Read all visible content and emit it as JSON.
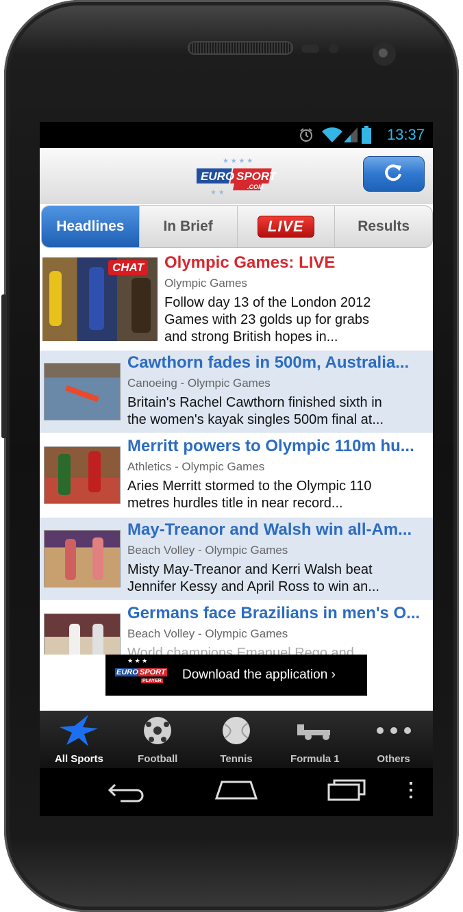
{
  "status_bar": {
    "time": "13:37",
    "icons": [
      "alarm-icon",
      "wifi-icon",
      "signal-icon",
      "battery-icon"
    ]
  },
  "header": {
    "logo_text_1": "EURO",
    "logo_text_2": "SPORT",
    "logo_text_3": ".COM"
  },
  "tabs": [
    {
      "label": "Headlines",
      "active": true
    },
    {
      "label": "In Brief",
      "active": false
    },
    {
      "label": "LIVE",
      "active": false
    },
    {
      "label": "Results",
      "active": false
    }
  ],
  "articles": [
    {
      "title": "Olympic Games: LIVE",
      "badge": "CHAT",
      "category": "Olympic Games",
      "desc": [
        "Follow day 13 of the London 2012",
        "Games with 23 golds up for grabs",
        "and strong British hopes in..."
      ]
    },
    {
      "title": "Cawthorn fades in 500m, Australia...",
      "category": "Canoeing - Olympic Games",
      "desc": [
        "Britain's Rachel Cawthorn finished sixth in",
        "the women's kayak singles 500m final at..."
      ]
    },
    {
      "title": "Merritt powers to Olympic 110m hu...",
      "category": "Athletics - Olympic Games",
      "desc": [
        "Aries Merritt stormed to the Olympic 110",
        "metres hurdles title in near record..."
      ]
    },
    {
      "title": "May-Treanor and Walsh win all-Am...",
      "category": "Beach Volley - Olympic Games",
      "desc": [
        "Misty May-Treanor and Kerri Walsh beat",
        "Jennifer Kessy and April Ross to win an..."
      ]
    },
    {
      "title": "Germans face Brazilians in men's O...",
      "category": "Beach Volley - Olympic Games",
      "desc": [
        "World champions Emanuel Rego and"
      ]
    }
  ],
  "banner": {
    "logo_1": "EURO",
    "logo_2": "SPORT",
    "logo_3": "PLAYER",
    "text": "Download the application ›"
  },
  "bottom_nav": [
    {
      "label": "All Sports",
      "icon": "star-icon"
    },
    {
      "label": "Football",
      "icon": "football-icon"
    },
    {
      "label": "Tennis",
      "icon": "tennis-ball-icon"
    },
    {
      "label": "Formula 1",
      "icon": "formula1-car-icon"
    },
    {
      "label": "Others",
      "icon": "more-dots-icon"
    }
  ],
  "colors": {
    "accent_blue": "#2c6cc0",
    "live_red": "#d7282f",
    "status_blue": "#33b5e5"
  }
}
